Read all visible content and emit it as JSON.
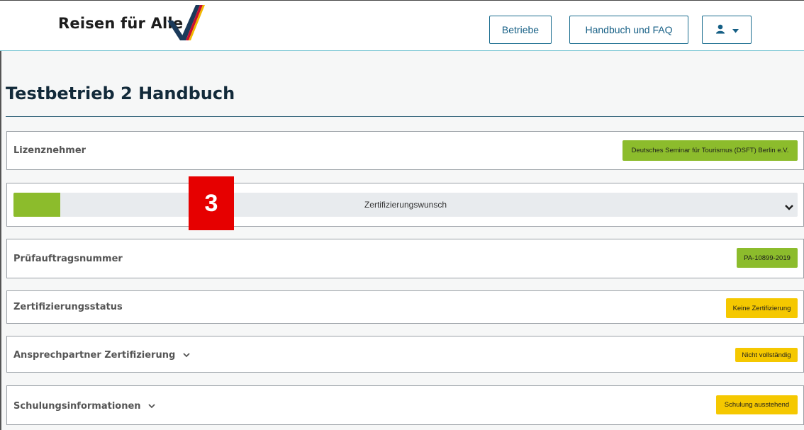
{
  "header": {
    "logo_text": "Reisen für Alle",
    "nav": {
      "betriebe": "Betriebe",
      "handbuch": "Handbuch und FAQ"
    },
    "user_menu_icon": "user-icon"
  },
  "page": {
    "title": "Testbetrieb 2 Handbuch"
  },
  "sections": {
    "lizenznehmer": {
      "label": "Lizenznehmer",
      "badge": "Deutsches Seminar für Tourismus (DSFT) Berlin e.V."
    },
    "zertifizierungswunsch": {
      "label": "Zertifizierungswunsch",
      "progress_fraction": 0.06
    },
    "pruefauftrag": {
      "label": "Prüfauftragsnummer",
      "badge": "PA-10899-2019"
    },
    "status": {
      "label": "Zertifizierungsstatus",
      "badge": "Keine Zertifizierung"
    },
    "ansprechpartner": {
      "label": "Ansprechpartner Zertifizierung",
      "badge": "Nicht vollständig"
    },
    "schulung": {
      "label": "Schulungsinformationen",
      "badge": "Schulung ausstehend"
    }
  },
  "overlay": {
    "step_number": "3"
  },
  "colors": {
    "accent_green": "#8cbc2c",
    "accent_yellow": "#f5c800",
    "nav_blue": "#155f85",
    "marker_red": "#e60000"
  }
}
